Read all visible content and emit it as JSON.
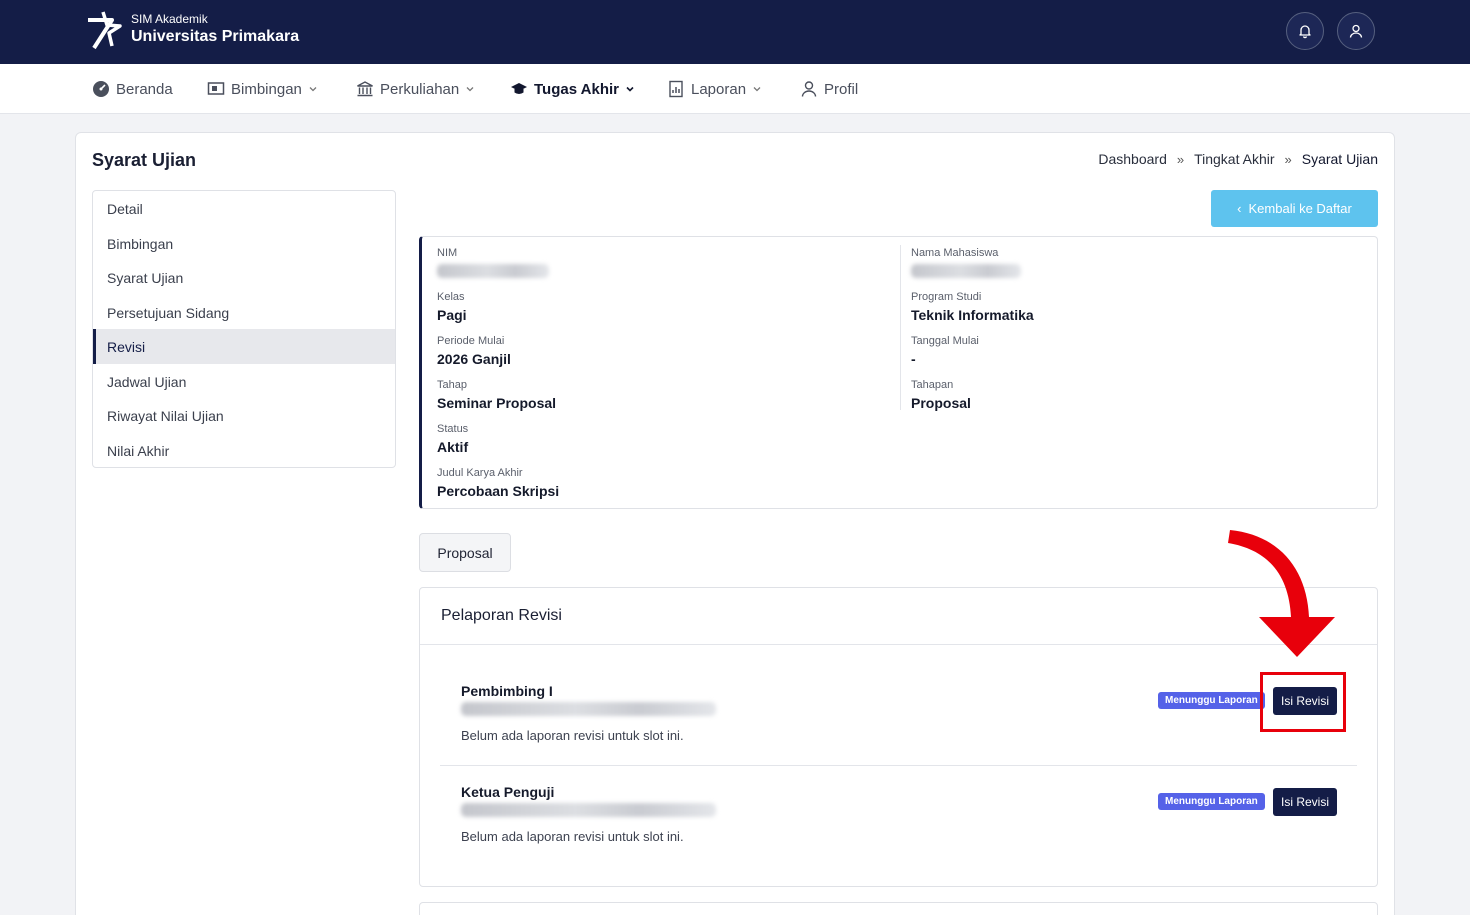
{
  "header": {
    "brand_small": "SIM Akademik",
    "brand_big": "Universitas Primakara",
    "icons": [
      "bell-icon",
      "user-icon"
    ]
  },
  "nav": {
    "items": [
      {
        "label": "Beranda",
        "icon": "dashboard-icon"
      },
      {
        "label": "Bimbingan",
        "icon": "presentation-icon"
      },
      {
        "label": "Perkuliahan",
        "icon": "institution-icon"
      },
      {
        "label": "Tugas Akhir",
        "icon": "graduation-cap-icon",
        "active": true
      },
      {
        "label": "Laporan",
        "icon": "report-icon"
      },
      {
        "label": "Profil",
        "icon": "person-icon"
      }
    ]
  },
  "page": {
    "title": "Syarat Ujian",
    "breadcrumb": [
      "Dashboard",
      "Tingkat Akhir",
      "Syarat Ujian"
    ]
  },
  "sidebar": {
    "items": [
      {
        "label": "Detail"
      },
      {
        "label": "Bimbingan"
      },
      {
        "label": "Syarat Ujian"
      },
      {
        "label": "Persetujuan Sidang"
      },
      {
        "label": "Revisi",
        "active": true
      },
      {
        "label": "Jadwal Ujian"
      },
      {
        "label": "Riwayat Nilai Ujian"
      },
      {
        "label": "Nilai Akhir"
      }
    ]
  },
  "back_button": "Kembali ke Daftar",
  "info": {
    "nim_label": "NIM",
    "nama_label": "Nama Mahasiswa",
    "kelas_label": "Kelas",
    "kelas_value": "Pagi",
    "prodi_label": "Program Studi",
    "prodi_value": "Teknik Informatika",
    "periode_label": "Periode Mulai",
    "periode_value": "2026 Ganjil",
    "tanggal_label": "Tanggal Mulai",
    "tanggal_value": "-",
    "tahap_label": "Tahap",
    "tahap_value": "Seminar Proposal",
    "tahapan_label": "Tahapan",
    "tahapan_value": "Proposal",
    "status_label": "Status",
    "status_value": "Aktif",
    "judul_label": "Judul Karya Akhir",
    "judul_value": "Percobaan Skripsi"
  },
  "tab": "Proposal",
  "revisi": {
    "title": "Pelaporan Revisi",
    "slots": [
      {
        "name": "Pembimbing I",
        "empty_text": "Belum ada laporan revisi untuk slot ini.",
        "badge": "Menunggu Laporan",
        "button": "Isi Revisi"
      },
      {
        "name": "Ketua Penguji",
        "empty_text": "Belum ada laporan revisi untuk slot ini.",
        "badge": "Menunggu Laporan",
        "button": "Isi Revisi"
      }
    ]
  },
  "colors": {
    "navy": "#141d47",
    "accent_blue": "#5ec3ee",
    "badge_purple": "#5562e8",
    "annotation_red": "#e8000b"
  }
}
